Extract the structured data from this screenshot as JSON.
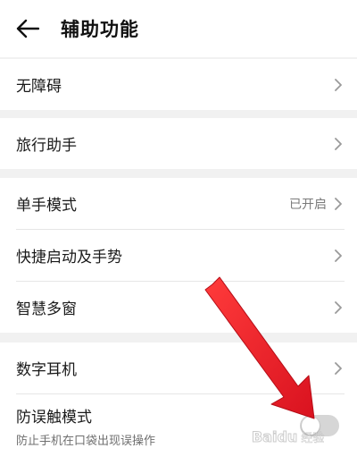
{
  "header": {
    "title": "辅助功能",
    "back_icon": "arrow-left-icon"
  },
  "groups": [
    {
      "items": [
        {
          "label": "无障碍",
          "value": ""
        }
      ]
    },
    {
      "items": [
        {
          "label": "旅行助手",
          "value": ""
        }
      ]
    },
    {
      "items": [
        {
          "label": "单手模式",
          "value": "已开启"
        },
        {
          "label": "快捷启动及手势",
          "value": ""
        },
        {
          "label": "智慧多窗",
          "value": ""
        }
      ]
    },
    {
      "items": [
        {
          "label": "数字耳机",
          "value": ""
        },
        {
          "label": "防误触模式",
          "sublabel": "防止手机在口袋出现误操作",
          "toggle_on": false
        }
      ]
    }
  ],
  "watermark": {
    "brand": "Baidu",
    "suffix": "经验"
  },
  "colors": {
    "annotation_arrow": "#e8202a",
    "toggle_off": "#d6d6d6",
    "background": "#f1f1f1"
  }
}
